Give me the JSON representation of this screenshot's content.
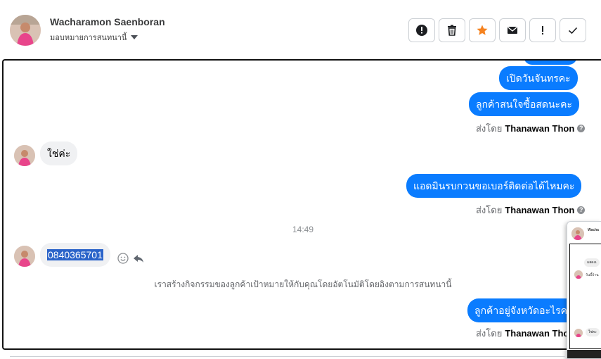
{
  "header": {
    "contact_name": "Wacharamon Saenboran",
    "assign_label": "มอบหมายการสนทนานี้",
    "toolbar_icons": [
      "alert-icon",
      "trash-icon",
      "star-icon",
      "mail-icon",
      "exclamation-icon",
      "check-icon"
    ],
    "star_color": "#f5821f"
  },
  "thread": {
    "messages_out_1": [
      "เปิดวันจันทรคะ",
      "ลูกค้าสนใจซื้อสดนะคะ"
    ],
    "sent_by_prefix": "ส่งโดย",
    "sent_by_name": "Thanawan Thon",
    "incoming_1": "ใช่ค่ะ",
    "message_out_2": "แอดมินรบกวนขอเบอร์ติดต่อได้ไหมคะ",
    "timestamp": "14:49",
    "incoming_2": "0840365701",
    "system_message": "เราสร้างกิจกรรมของลูกค้าเป้าหมายให้กับคุณโดยอัตโนมัติโดยอิงตามการสนทนานี้",
    "message_out_3": "ลูกค้าอยู่จังหวัดอะไรคะ",
    "bubble_color": "#0a7cff"
  },
  "popup": {
    "name_snippet": "Wacha",
    "bubble1": "แสดงเ",
    "bubble2": "วันนี้ร้าน",
    "bubble3": "ใช่คะ"
  }
}
